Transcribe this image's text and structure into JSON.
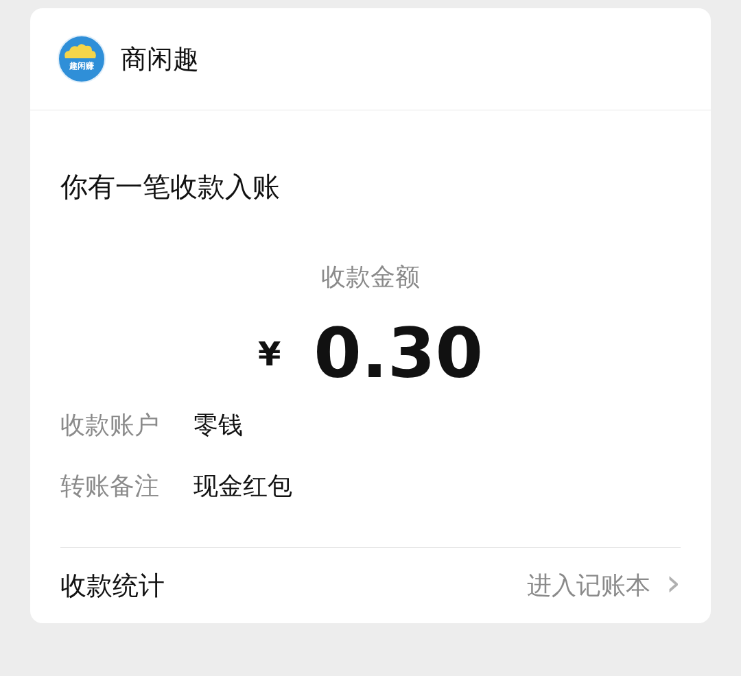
{
  "header": {
    "logo_text": "趣闲赚",
    "name": "商闲趣"
  },
  "title": "你有一笔收款入账",
  "amount": {
    "label": "收款金额",
    "currency": "¥",
    "value": "0.30"
  },
  "details": [
    {
      "label": "收款账户",
      "value": "零钱"
    },
    {
      "label": "转账备注",
      "value": "现金红包"
    }
  ],
  "footer": {
    "label": "收款统计",
    "link": "进入记账本",
    "chevron": "›"
  }
}
